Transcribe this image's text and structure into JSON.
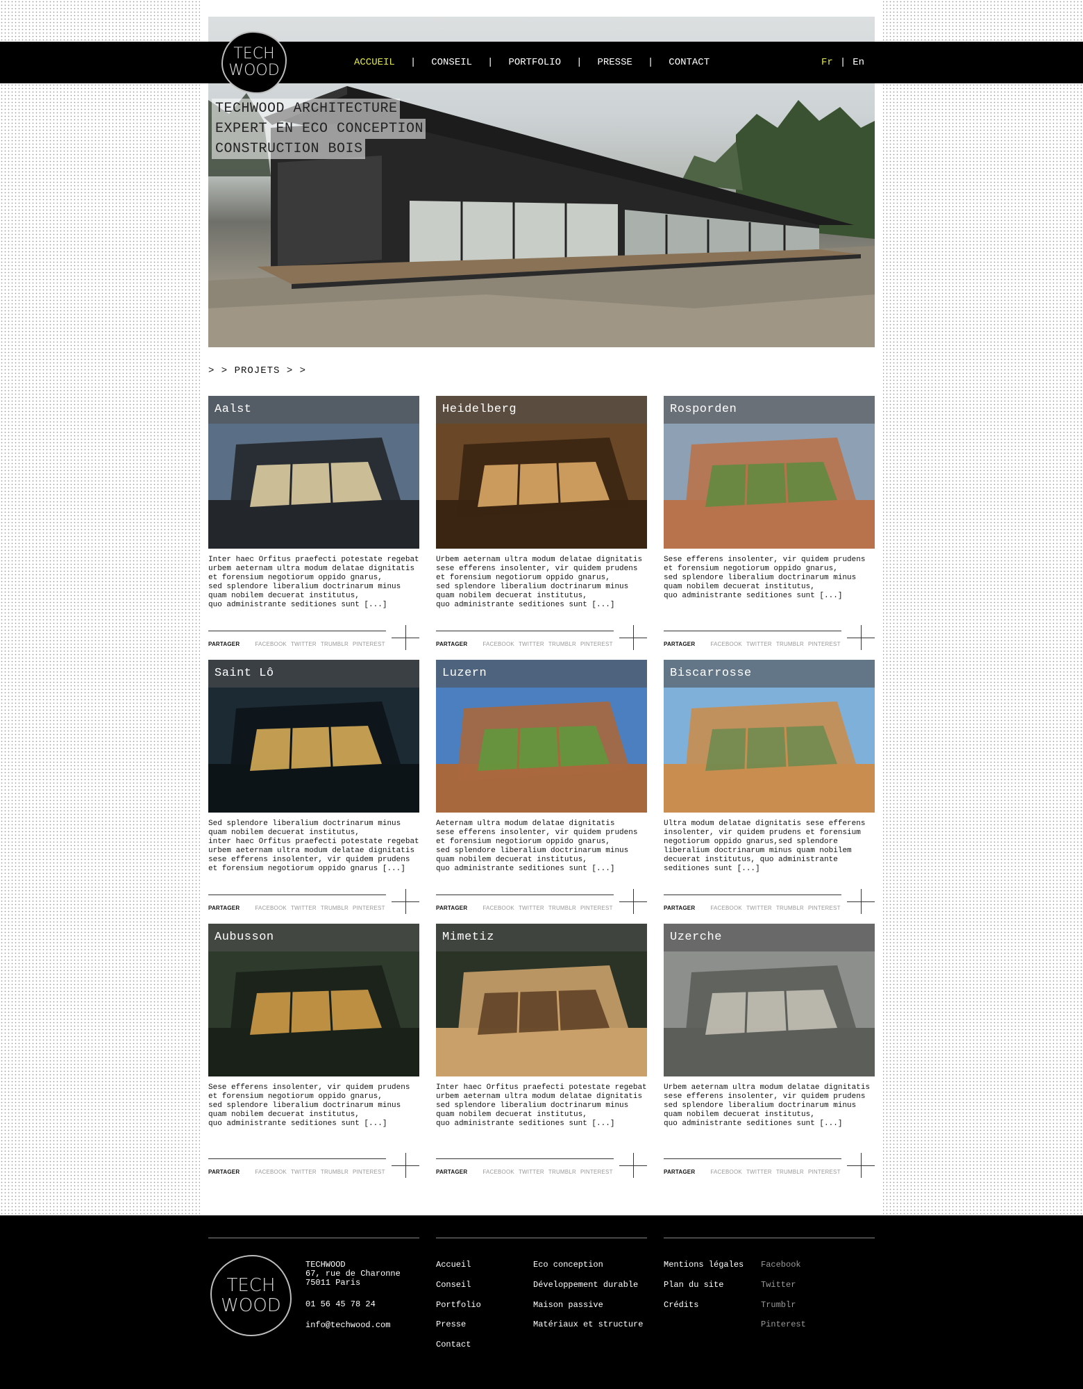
{
  "brand": {
    "logo_line1": "TECH",
    "logo_line2": "WOOD"
  },
  "nav": {
    "items": [
      "ACCUEIL",
      "CONSEIL",
      "PORTFOLIO",
      "PRESSE",
      "CONTACT"
    ],
    "active": "ACCUEIL",
    "separator": "|",
    "lang_fr": "Fr",
    "lang_en": "En",
    "lang_separator": "|"
  },
  "hero": {
    "lines": [
      "TECHWOOD ARCHITECTURE",
      "EXPERT EN ECO CONCEPTION",
      "CONSTRUCTION BOIS"
    ]
  },
  "section": {
    "title": "> > PROJETS > >"
  },
  "share": {
    "label": "PARTAGER",
    "networks": [
      "FACEBOOK",
      "TWITTER",
      "TRUMBLR",
      "PINTEREST"
    ]
  },
  "projects": [
    {
      "title": "Aalst",
      "text": "Inter haec Orfitus praefecti potestate regebat\nurbem aeternam ultra modum delatae dignitatis\net forensium negotiorum oppido gnarus,\nsed splendore liberalium doctrinarum minus\nquam nobilem decuerat institutus,\nquo administrante seditiones sunt [...]"
    },
    {
      "title": "Heidelberg",
      "text": "Urbem aeternam ultra modum delatae dignitatis\nsese efferens insolenter, vir quidem prudens\net forensium negotiorum oppido gnarus,\nsed splendore liberalium doctrinarum minus\nquam nobilem decuerat institutus,\nquo administrante seditiones sunt [...]"
    },
    {
      "title": "Rosporden",
      "text": "Sese efferens insolenter, vir quidem prudens\net forensium negotiorum oppido gnarus,\nsed splendore liberalium doctrinarum minus\nquam nobilem decuerat institutus,\nquo administrante seditiones sunt [...]"
    },
    {
      "title": "Saint Lô",
      "text": "Sed splendore liberalium doctrinarum minus\nquam nobilem decuerat institutus,\ninter haec Orfitus praefecti potestate regebat\nurbem aeternam ultra modum delatae dignitatis\nsese efferens insolenter, vir quidem prudens\net forensium negotiorum oppido gnarus [...]"
    },
    {
      "title": "Luzern",
      "text": "Aeternam ultra modum delatae dignitatis\nsese efferens insolenter, vir quidem prudens\net forensium negotiorum oppido gnarus,\nsed splendore liberalium doctrinarum minus\nquam nobilem decuerat institutus,\nquo administrante seditiones sunt [...]"
    },
    {
      "title": "Biscarrosse",
      "text": "Ultra modum delatae dignitatis sese efferens\ninsolenter, vir quidem prudens et forensium\nnegotiorum oppido gnarus,sed splendore\nliberalium doctrinarum minus quam nobilem\ndecuerat institutus, quo administrante\nseditiones sunt [...]"
    },
    {
      "title": "Aubusson",
      "text": "Sese efferens insolenter, vir quidem prudens\net forensium negotiorum oppido gnarus,\nsed splendore liberalium doctrinarum minus\nquam nobilem decuerat institutus,\nquo administrante seditiones sunt [...]"
    },
    {
      "title": "Mimetiz",
      "text": "Inter haec Orfitus praefecti potestate regebat\nurbem aeternam ultra modum delatae dignitatis\nsed splendore liberalium doctrinarum minus\nquam nobilem decuerat institutus,\nquo administrante seditiones sunt [...]"
    },
    {
      "title": "Uzerche",
      "text": "Urbem aeternam ultra modum delatae dignitatis\nsese efferens insolenter, vir quidem prudens\nsed splendore liberalium doctrinarum minus\nquam nobilem decuerat institutus,\nquo administrante seditiones sunt [...]"
    }
  ],
  "footer": {
    "company": "TECHWOOD",
    "address1": "67, rue de Charonne",
    "address2": "75011 Paris",
    "phone": "01 56 45 78 24",
    "email": "info@techwood.com",
    "col1": [
      "Accueil",
      "Conseil",
      "Portfolio",
      "Presse",
      "Contact"
    ],
    "col2": [
      "Eco conception",
      "Développement durable",
      "Maison passive",
      "Matériaux et structure"
    ],
    "col3": [
      "Mentions légales",
      "Plan du site",
      "Crédits"
    ],
    "social": [
      "Facebook",
      "Twitter",
      "Trumblr",
      "Pinterest"
    ]
  },
  "colors": {
    "accent": "#e2e84a",
    "nav_bg": "#000000",
    "footer_bg": "#000000"
  }
}
